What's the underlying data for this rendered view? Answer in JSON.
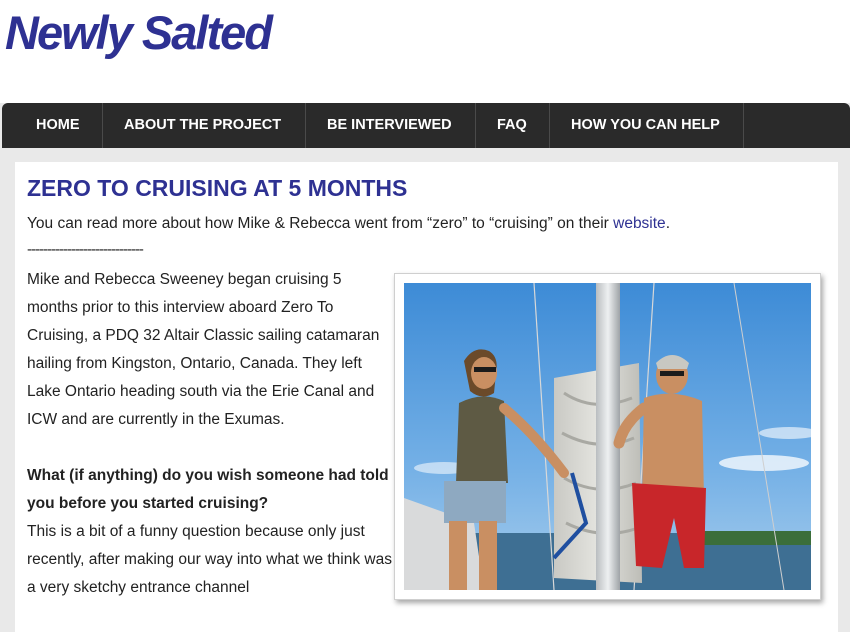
{
  "site": {
    "title": "Newly Salted"
  },
  "nav": {
    "items": [
      {
        "label": "HOME"
      },
      {
        "label": "ABOUT THE PROJECT"
      },
      {
        "label": "BE INTERVIEWED"
      },
      {
        "label": "FAQ"
      },
      {
        "label": "HOW YOU CAN HELP"
      }
    ]
  },
  "post": {
    "title": "ZERO TO CRUISING AT 5 MONTHS",
    "intro_prefix": "You can read more about how Mike & Rebecca went from “zero” to “cruising” on their ",
    "intro_link": "website",
    "intro_suffix": ".",
    "divider": "-----------------------------",
    "paragraph1": "Mike and Rebecca Sweeney began cruising 5 months prior to this interview aboard Zero To Cruising, a PDQ 32 Altair Classic sailing catamaran hailing from Kingston, Ontario, Canada. They left Lake Ontario heading south via the Erie Canal and ICW and are currently in the Exumas.",
    "question1": "What (if anything) do you wish someone had told you before you started cruising?",
    "answer1": "This is a bit of a funny question because only just recently, after making our way into what we think was a very sketchy entrance channel"
  },
  "colors": {
    "brand": "#2e3192",
    "nav_bg": "#2a2a2a",
    "page_bg": "#e9e9e9"
  }
}
